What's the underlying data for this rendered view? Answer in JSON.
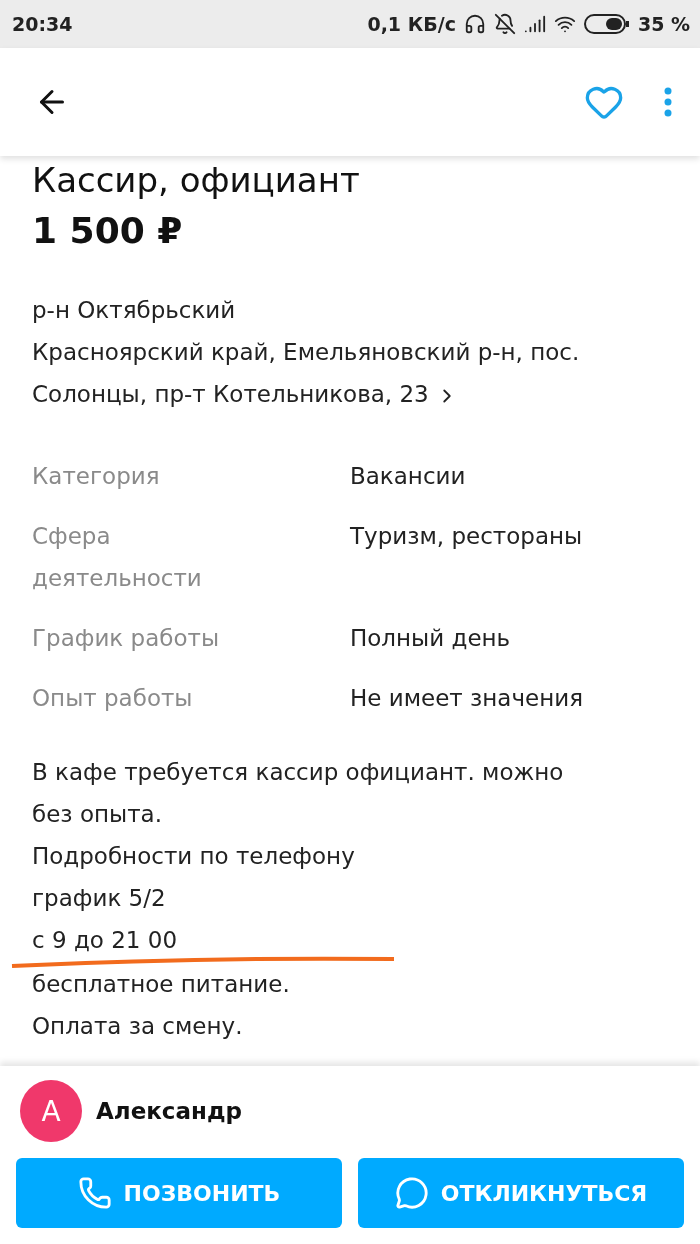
{
  "status_bar": {
    "time": "20:34",
    "speed": "0,1 КБ/с",
    "battery": "35 %"
  },
  "title": "Кассир, официант",
  "price": "1 500 ₽",
  "district": "р-н Октябрьский",
  "address": "Красноярский край, Емельяновский р-н, пос. Солонцы, пр-т Котельникова, 23",
  "details": [
    {
      "label": "Категория",
      "value": "Вакансии"
    },
    {
      "label": "Сфера деятельности",
      "value": "Туризм, рестораны"
    },
    {
      "label": "График работы",
      "value": "Полный день"
    },
    {
      "label": "Опыт работы",
      "value": "Не имеет значения"
    }
  ],
  "description": [
    {
      "text": "В кафе требуется кассир официант. можно без опыта.",
      "underlined": false
    },
    {
      "text": "Подробности по телефону",
      "underlined": false
    },
    {
      "text": "график 5/2",
      "underlined": false
    },
    {
      "text": "с 9 до 21 00",
      "underlined": true
    },
    {
      "text": "бесплатное питание.",
      "underlined": false
    },
    {
      "text": "Оплата за смену.",
      "underlined": false
    }
  ],
  "seller": {
    "initial": "А",
    "name": "Александр",
    "color": "#f0386b"
  },
  "actions": [
    {
      "kind": "call",
      "label": "ПОЗВОНИТЬ"
    },
    {
      "kind": "reply",
      "label": "ОТКЛИКНУТЬСЯ"
    }
  ]
}
